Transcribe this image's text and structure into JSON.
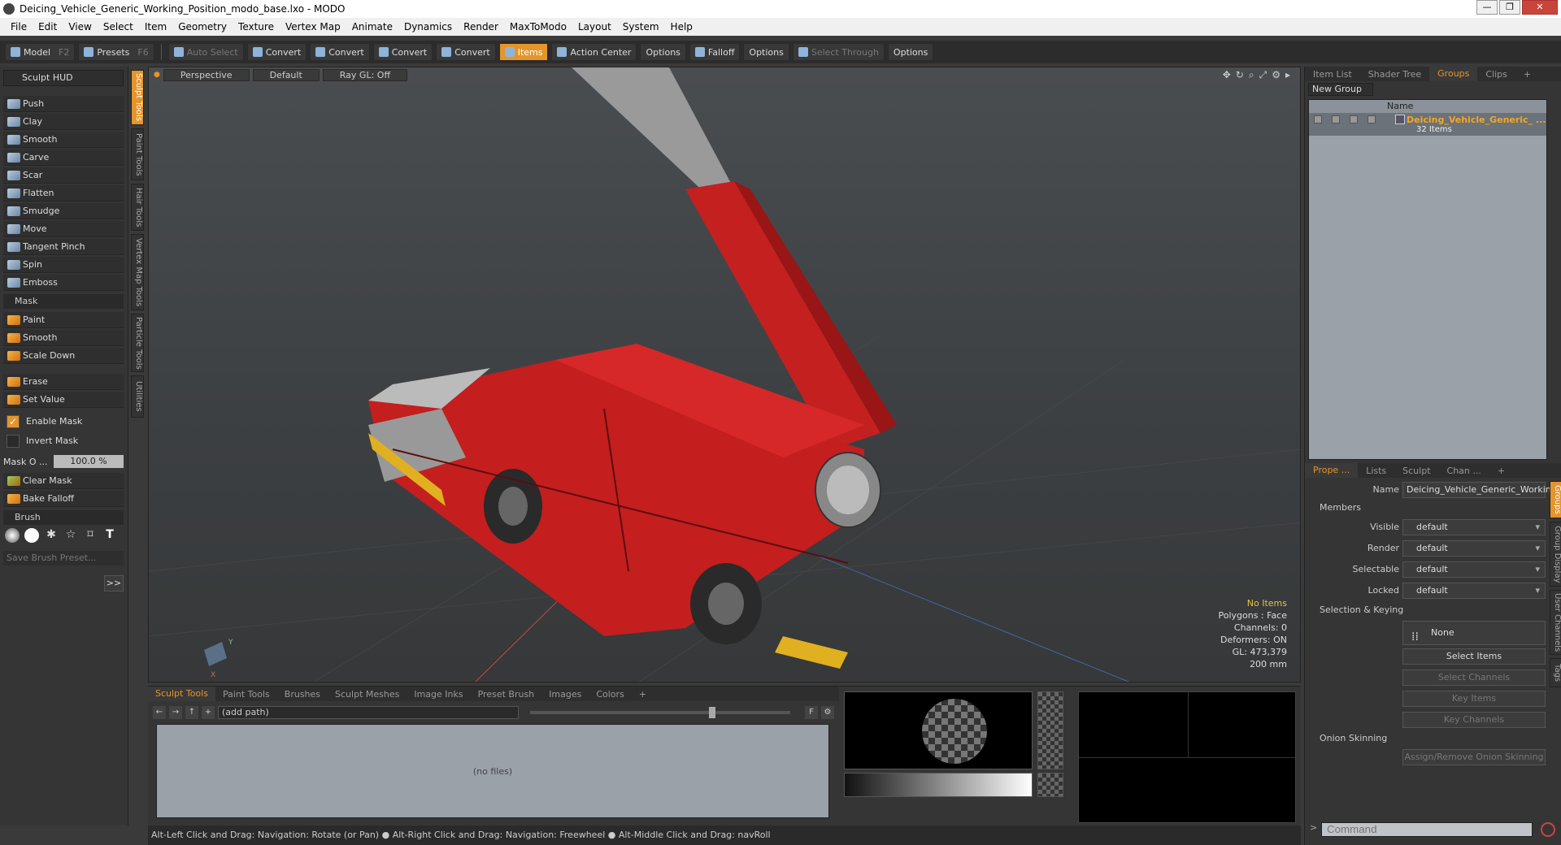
{
  "window": {
    "title": "Deicing_Vehicle_Generic_Working_Position_modo_base.lxo - MODO",
    "min": "—",
    "max": "❐",
    "close": "✕"
  },
  "menu": [
    "File",
    "Edit",
    "View",
    "Select",
    "Item",
    "Geometry",
    "Texture",
    "Vertex Map",
    "Animate",
    "Dynamics",
    "Render",
    "MaxToModo",
    "Layout",
    "System",
    "Help"
  ],
  "toolbar": {
    "model": "Model",
    "model_key": "F2",
    "presets": "Presets",
    "presets_key": "F6",
    "auto_select": "Auto Select",
    "convert1": "Convert",
    "convert2": "Convert",
    "convert3": "Convert",
    "convert4": "Convert",
    "items": "Items",
    "action_center": "Action Center",
    "options1": "Options",
    "falloff": "Falloff",
    "options2": "Options",
    "select_through": "Select Through",
    "options3": "Options"
  },
  "left": {
    "sculpt_hud": "Sculpt HUD",
    "tools": [
      "Push",
      "Clay",
      "Smooth",
      "Carve",
      "Scar",
      "Flatten",
      "Smudge",
      "Move",
      "Tangent Pinch",
      "Spin",
      "Emboss"
    ],
    "mask_header": "Mask",
    "mask_tools": [
      "Paint",
      "Smooth",
      "Scale Down"
    ],
    "erase": "Erase",
    "set_value": "Set Value",
    "enable_mask": "Enable Mask",
    "invert_mask": "Invert Mask",
    "mask_opacity_label": "Mask O ...",
    "mask_opacity_value": "100.0 %",
    "clear_mask": "Clear Mask",
    "bake_falloff": "Bake Falloff",
    "brush_header": "Brush",
    "save_brush_preset": "Save Brush Preset...",
    "expand": ">>",
    "checkmark": "✓"
  },
  "vtabs": [
    "Sculpt Tools",
    "Paint Tools",
    "Hair Tools",
    "Vertex Map Tools",
    "Particle Tools",
    "Utilities"
  ],
  "viewport": {
    "perspective": "Perspective",
    "default": "Default",
    "raygl": "Ray GL: Off",
    "stats": {
      "no_items": "No Items",
      "polygons": "Polygons : Face",
      "channels": "Channels: 0",
      "deformers": "Deformers: ON",
      "gl": "GL: 473,379",
      "scale": "200 mm"
    }
  },
  "bottom": {
    "tabs": [
      "Sculpt Tools",
      "Paint Tools",
      "Brushes",
      "Sculpt Meshes",
      "Image Inks",
      "Preset Brush",
      "Images",
      "Colors",
      "+"
    ],
    "path": "(add path)",
    "no_files": "(no files)",
    "nav": {
      "back": "←",
      "fwd": "→",
      "up": "↑",
      "add": "+",
      "f": "F",
      "gear": "⚙"
    }
  },
  "status": "Alt-Left Click and Drag: Navigation: Rotate (or Pan) ● Alt-Right Click and Drag: Navigation: Freewheel ● Alt-Middle Click and Drag: navRoll",
  "right": {
    "top_tabs": [
      "Item List",
      "Shader Tree",
      "Groups",
      "Clips",
      "+"
    ],
    "new_group": "New Group",
    "name_col": "Name",
    "group_name": "Deicing_Vehicle_Generic_ ...",
    "group_count": "32 Items",
    "prop_tabs": [
      "Prope ...",
      "Lists",
      "Sculpt",
      "Chan ...",
      "+"
    ],
    "name_label": "Name",
    "name_value": "Deicing_Vehicle_Generic_Working_",
    "members": "Members",
    "visible_label": "Visible",
    "visible_value": "default",
    "render_label": "Render",
    "render_value": "default",
    "selectable_label": "Selectable",
    "selectable_value": "default",
    "locked_label": "Locked",
    "locked_value": "default",
    "sel_keying": "Selection & Keying",
    "none": "None",
    "select_items": "Select Items",
    "select_channels": "Select Channels",
    "key_items": "Key Items",
    "key_channels": "Key Channels",
    "onion": "Onion Skinning",
    "assign_onion": "Assign/Remove Onion Skinning",
    "side_tabs": [
      "Groups",
      "Group Display",
      "User Channels",
      "Tags"
    ],
    "command_placeholder": "Command"
  }
}
